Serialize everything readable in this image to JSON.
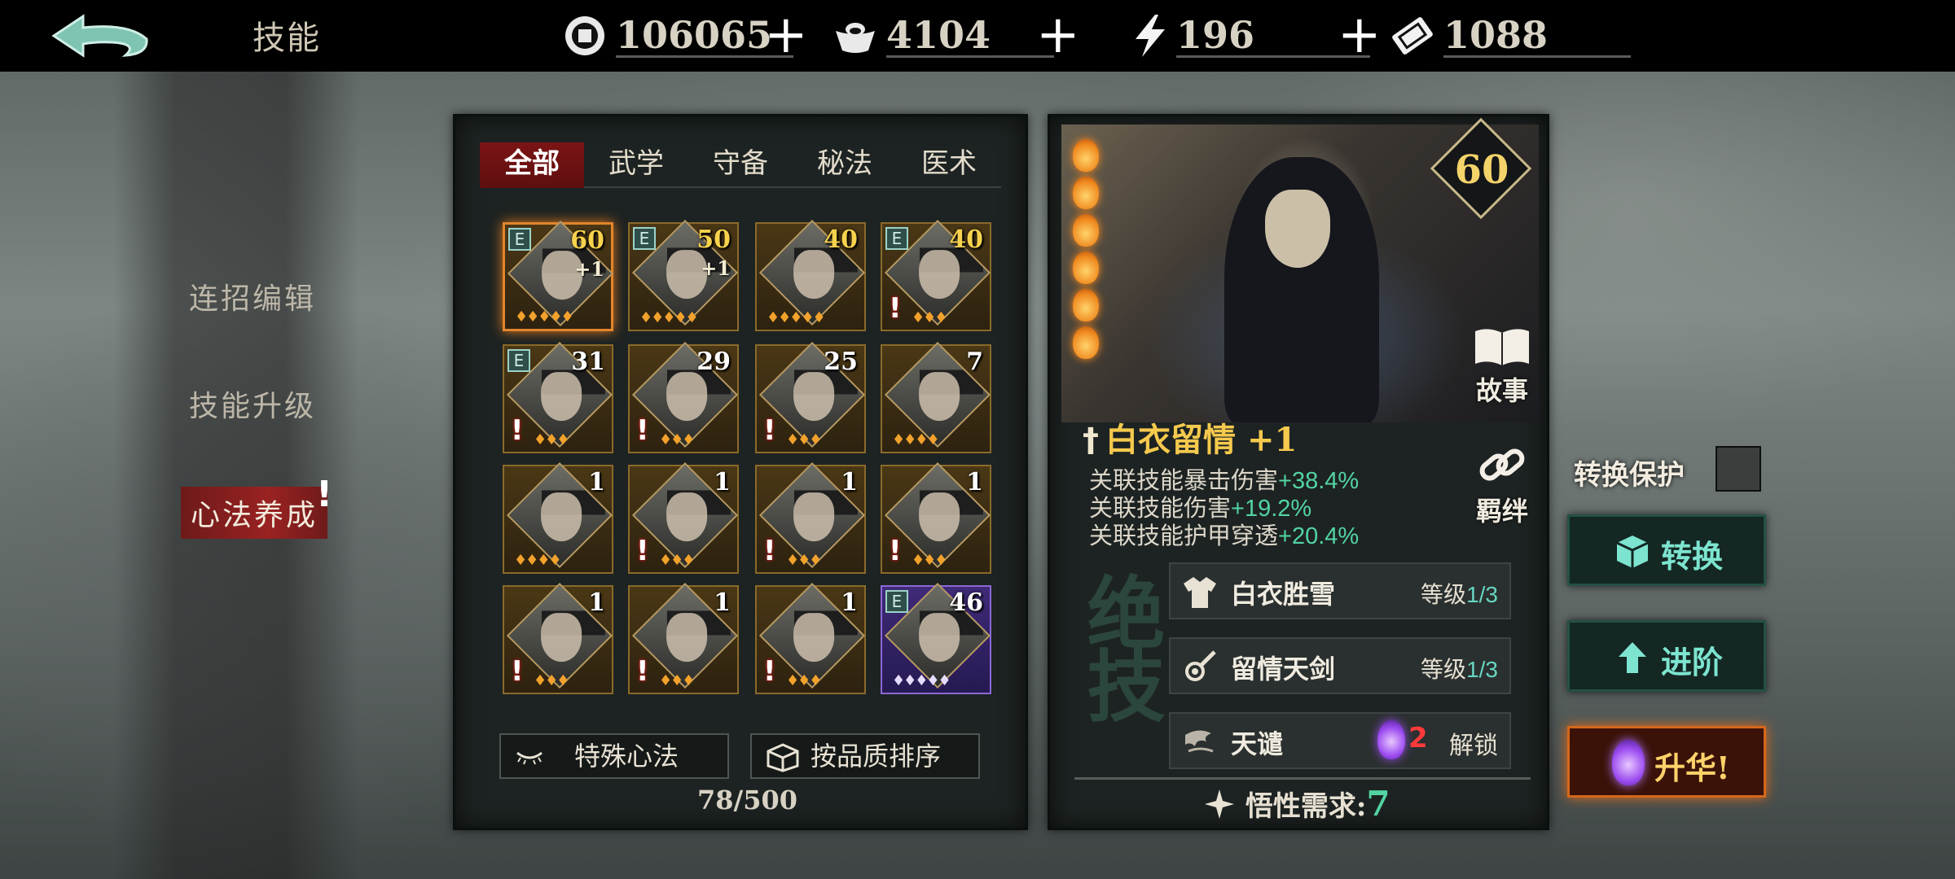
{
  "header": {
    "title": "技能",
    "resources": [
      {
        "icon": "coin-icon",
        "value": "106065"
      },
      {
        "icon": "silver-ingot-icon",
        "value": "4104"
      },
      {
        "icon": "lightning-icon",
        "value": "196"
      },
      {
        "icon": "ticket-icon",
        "value": "1088"
      }
    ],
    "plus": "+"
  },
  "nav": {
    "items": [
      {
        "label": "连招编辑"
      },
      {
        "label": "技能升级"
      },
      {
        "label": "心法养成"
      }
    ],
    "alert": "!"
  },
  "tabs": [
    "全部",
    "武学",
    "守备",
    "秘法",
    "医术"
  ],
  "cards": [
    {
      "level": "60",
      "plus": "+1",
      "e": true,
      "warn": false,
      "gold": true,
      "selected": true,
      "flames": "🔥🔥🔥🔥🔥"
    },
    {
      "level": "50",
      "plus": "+1",
      "e": true,
      "warn": false,
      "gold": true,
      "flames": "🔥🔥🔥🔥🔥"
    },
    {
      "level": "40",
      "plus": "",
      "e": false,
      "warn": false,
      "gold": true,
      "flames": "🔥🔥🔥🔥🔥"
    },
    {
      "level": "40",
      "plus": "",
      "e": true,
      "warn": true,
      "gold": true,
      "flames": "🔥🔥🔥"
    },
    {
      "level": "31",
      "plus": "",
      "e": true,
      "warn": true,
      "gold": false,
      "flames": "🔥🔥🔥"
    },
    {
      "level": "29",
      "plus": "",
      "e": false,
      "warn": true,
      "gold": false,
      "flames": "🔥🔥🔥"
    },
    {
      "level": "25",
      "plus": "",
      "e": false,
      "warn": true,
      "gold": false,
      "flames": "🔥🔥🔥"
    },
    {
      "level": "7",
      "plus": "",
      "e": false,
      "warn": false,
      "gold": false,
      "flames": "🔥🔥🔥🔥"
    },
    {
      "level": "1",
      "plus": "",
      "e": false,
      "warn": false,
      "gold": false,
      "flames": "🔥🔥🔥🔥"
    },
    {
      "level": "1",
      "plus": "",
      "e": false,
      "warn": true,
      "gold": false,
      "flames": "🔥🔥🔥"
    },
    {
      "level": "1",
      "plus": "",
      "e": false,
      "warn": true,
      "gold": false,
      "flames": "🔥🔥🔥"
    },
    {
      "level": "1",
      "plus": "",
      "e": false,
      "warn": true,
      "gold": false,
      "flames": "🔥🔥🔥"
    },
    {
      "level": "1",
      "plus": "",
      "e": false,
      "warn": true,
      "gold": false,
      "flames": "🔥🔥🔥"
    },
    {
      "level": "1",
      "plus": "",
      "e": false,
      "warn": true,
      "gold": false,
      "flames": "🔥🔥🔥"
    },
    {
      "level": "1",
      "plus": "",
      "e": false,
      "warn": true,
      "gold": false,
      "flames": "🔥🔥🔥"
    },
    {
      "level": "46",
      "plus": "",
      "e": true,
      "warn": false,
      "gold": false,
      "purple": true,
      "flames": "🔥🔥🔥🔥🔥"
    }
  ],
  "buttons": {
    "special": "特殊心法",
    "sort": "按品质排序"
  },
  "count": "78/500",
  "detail": {
    "level": "60",
    "story": "故事",
    "bond": "羁绊",
    "name": "白衣留情",
    "name_plus": "+1",
    "stats": [
      {
        "label": "关联技能暴击伤害",
        "value": "+38.4%"
      },
      {
        "label": "关联技能伤害",
        "value": "+19.2%"
      },
      {
        "label": "关联技能护甲穿透",
        "value": "+20.4%"
      }
    ],
    "jue": "绝技",
    "rows": [
      {
        "name": "白衣胜雪",
        "lvl_label": "等级",
        "lvl": "1/3"
      },
      {
        "name": "留情天剑",
        "lvl_label": "等级",
        "lvl": "1/3"
      },
      {
        "name": "天谴",
        "cost": "2",
        "unlock": "解锁"
      }
    ],
    "wuxing_label": "悟性需求:",
    "wuxing": "7"
  },
  "right": {
    "protect": "转换保护",
    "convert": "转换",
    "advance": "进阶",
    "ascend": "升华!"
  },
  "colors": {
    "accent_red": "#7c1414",
    "gold": "#f5c94d",
    "teal": "#52d4a3",
    "orange": "#e3852b"
  }
}
